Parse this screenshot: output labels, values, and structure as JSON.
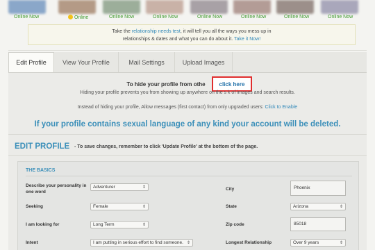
{
  "online_strip": {
    "items": [
      {
        "label": "Online Now",
        "smiley": false,
        "color": "#8aa7c9"
      },
      {
        "label": "Online",
        "smiley": true,
        "color": "#b49a86"
      },
      {
        "label": "Online Now",
        "smiley": false,
        "color": "#9cae9a"
      },
      {
        "label": "Online Now",
        "smiley": false,
        "color": "#c9b2a7"
      },
      {
        "label": "Online Now",
        "smiley": false,
        "color": "#a8a1a6"
      },
      {
        "label": "Online Now",
        "smiley": false,
        "color": "#b39c96"
      },
      {
        "label": "Online Now",
        "smiley": false,
        "color": "#9c8f8a"
      },
      {
        "label": "Online Now",
        "smiley": false,
        "color": "#a9a7bb"
      }
    ]
  },
  "notice": {
    "pre": "Take the ",
    "link1": "relationship needs test",
    "mid": ", it will tell you all the ways you mess up in",
    "line2": "relationships & dates and what you can do about it. ",
    "link2": "Take it Now!"
  },
  "tabs": [
    {
      "label": "Edit Profile",
      "active": true
    },
    {
      "label": "View Your Profile",
      "active": false
    },
    {
      "label": "Mail Settings",
      "active": false
    },
    {
      "label": "Upload Images",
      "active": false
    }
  ],
  "hide_profile": {
    "title": "To hide your profile from othe",
    "click_here": "click here",
    "desc": "Hiding your profile prevents you from showing up anywhere on the s                  k of images and search results."
  },
  "messages": {
    "text": "Instead of hiding your profile, Allow messages (first contact) from only upgraded users: ",
    "link": "Click to Enable"
  },
  "warning": "If your profile contains sexual language of any kind your account will be deleted.",
  "edit_profile": {
    "title": "EDIT PROFILE",
    "subtitle": "- To save changes, remember to click 'Update Profile' at the bottom of the page."
  },
  "basics": {
    "title": "THE BASICS",
    "personality_label": "Describe your personality in one word",
    "personality_value": "Adventurer",
    "seeking_label": "Seeking",
    "seeking_value": "Female",
    "looking_for_label": "I am looking for",
    "looking_for_value": "Long Term",
    "intent_label": "Intent",
    "intent_value": "I am putting in serious effort to find someone.",
    "city_label": "City",
    "city_value": "Phoenix",
    "state_label": "State",
    "state_value": "Arizona",
    "zip_label": "Zip code",
    "zip_value": "85018",
    "longest_label": "Longest Relationship",
    "longest_value": "Over 9 years"
  },
  "colors": {
    "accent": "#3b8fb9",
    "link": "#2f87b8",
    "online_green": "#3f9a2e",
    "highlight_red": "#e02d2d"
  }
}
